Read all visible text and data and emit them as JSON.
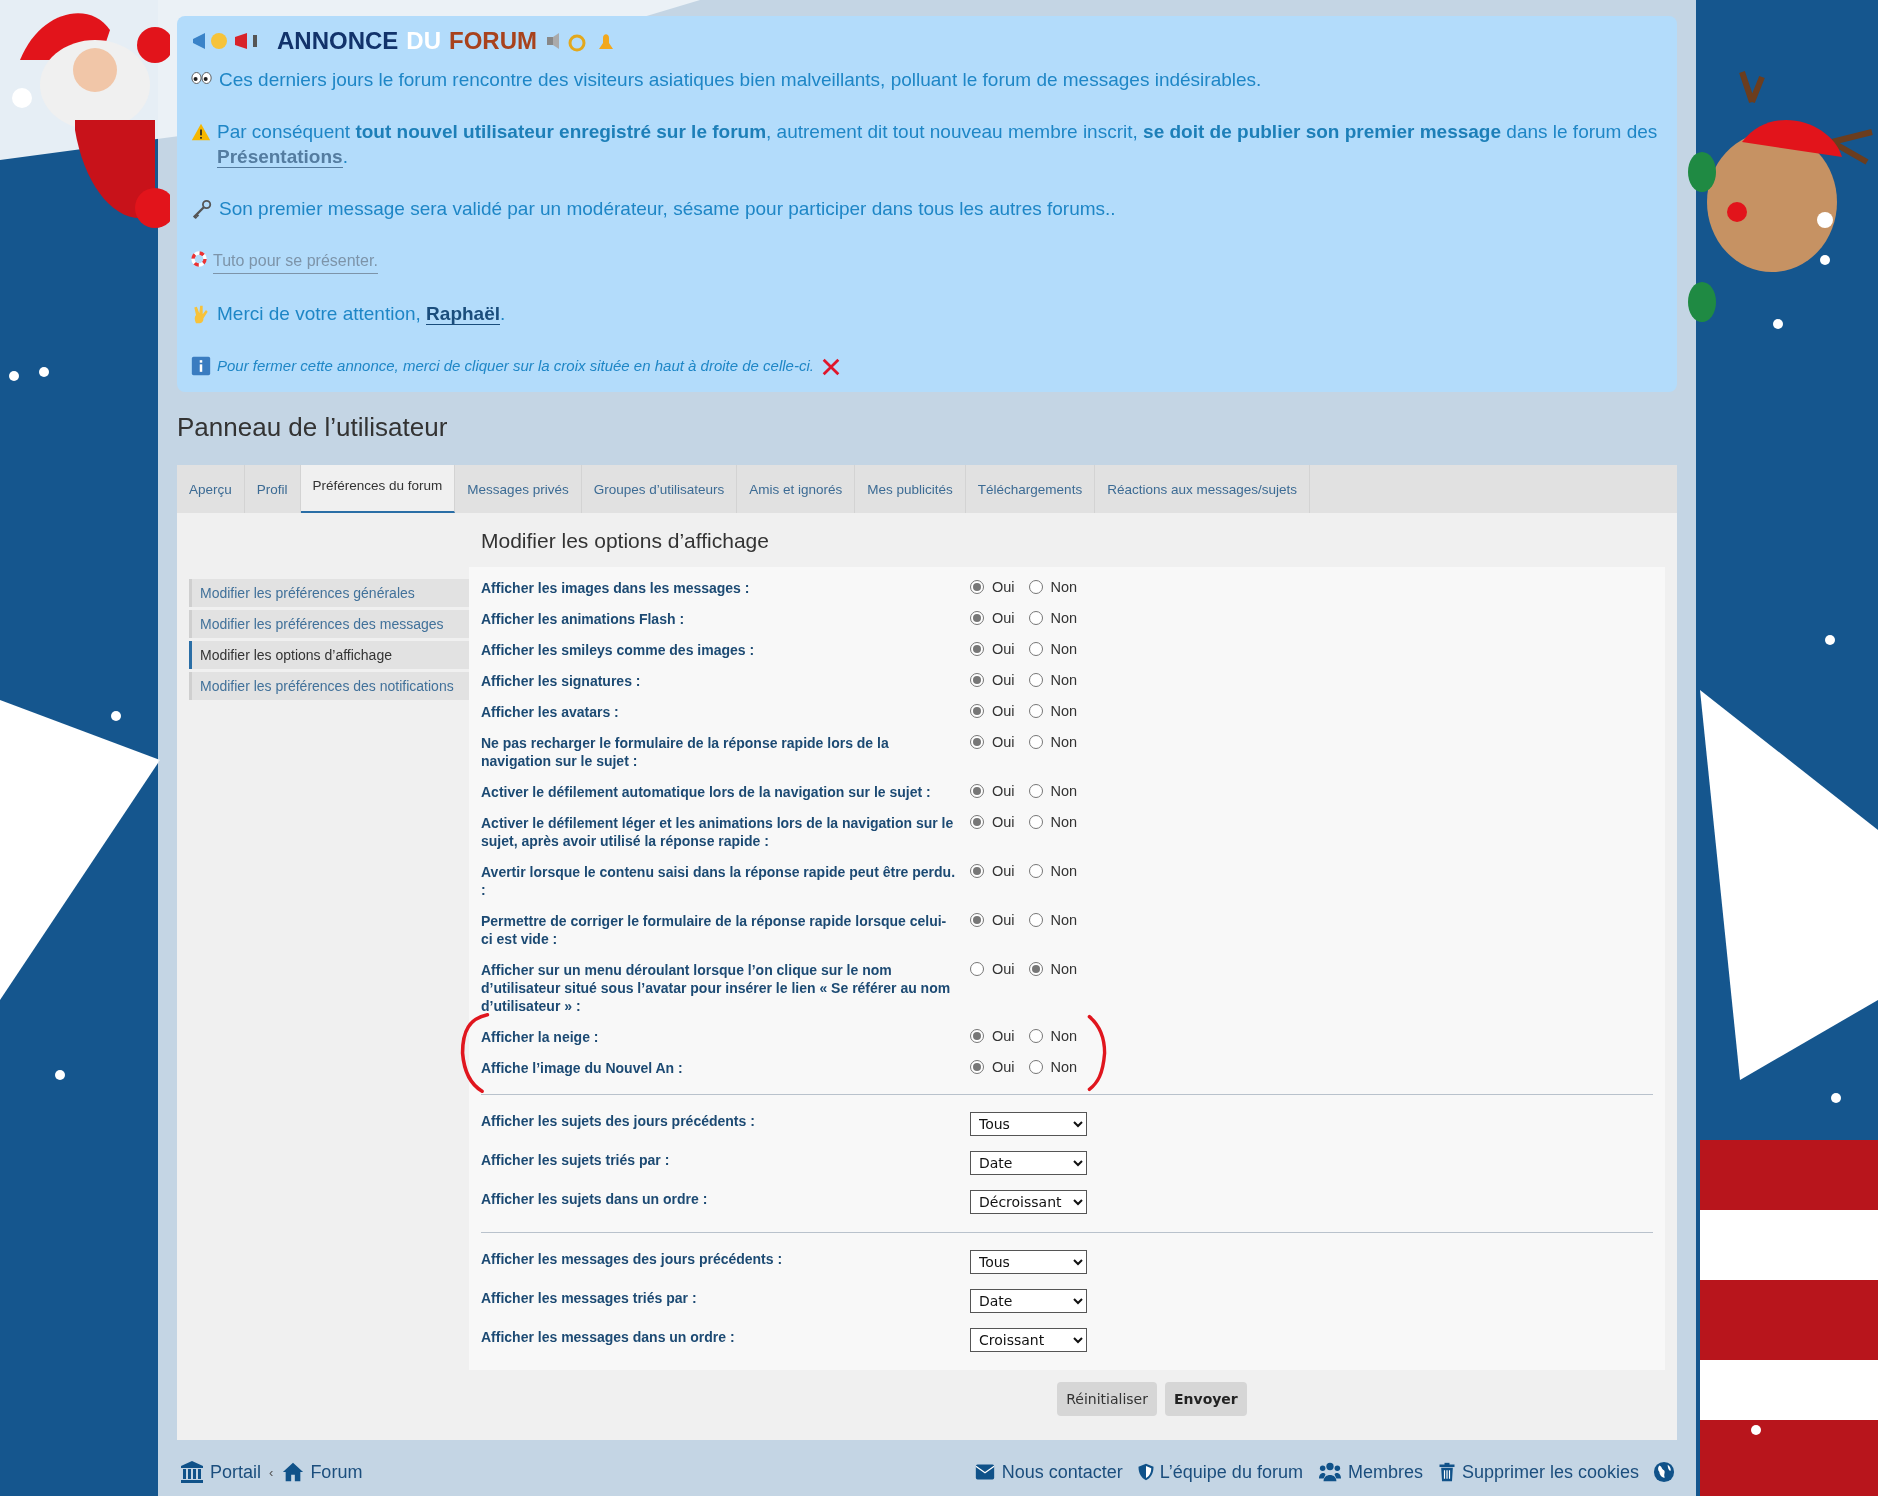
{
  "announcement": {
    "title_parts": [
      {
        "text": "ANNONCE",
        "color": "#12336b"
      },
      {
        "text": "DU",
        "color": "#ffffff"
      },
      {
        "text": "FORUM",
        "color": "#a8421c"
      }
    ],
    "paragraphs": [
      {
        "kind": "eyes",
        "text": "Ces derniers jours le forum rencontre des visiteurs asiatiques bien malveillants, polluant le forum de messages indésirables."
      },
      {
        "kind": "warning",
        "text": "Par conséquent **tout nouvel utilisateur enregistré sur le forum**, autrement dit tout nouveau membre inscrit, **se doit de publier son premier message** dans le forum des",
        "link": "Présentations",
        "after": "."
      },
      {
        "kind": "key",
        "text": "Son premier message sera validé par un modérateur, sésame pour participer dans tous les autres forums.."
      },
      {
        "kind": "lifebuoy",
        "link": "Tuto pour se présenter."
      },
      {
        "kind": "hand",
        "text": "Merci de votre attention,",
        "link": "Raphaël",
        "after": "."
      },
      {
        "kind": "info",
        "text": "Pour fermer cette annonce, merci de cliquer sur la croix située en haut à droite de celle-ci."
      }
    ]
  },
  "page_title": "Panneau de l’utilisateur",
  "tabs": [
    {
      "label": "Aperçu",
      "selected": false
    },
    {
      "label": "Profil",
      "selected": false
    },
    {
      "label": "Préférences du forum",
      "selected": true
    },
    {
      "label": "Messages privés",
      "selected": false
    },
    {
      "label": "Groupes d’utilisateurs",
      "selected": false
    },
    {
      "label": "Amis et ignorés",
      "selected": false
    },
    {
      "label": "Mes publicités",
      "selected": false
    },
    {
      "label": "Téléchargements",
      "selected": false
    },
    {
      "label": "Réactions aux messages/sujets",
      "selected": false
    }
  ],
  "sidebar": {
    "items": [
      {
        "label": "Modifier les préférences générales",
        "selected": false
      },
      {
        "label": "Modifier les préférences des messages",
        "selected": false
      },
      {
        "label": "Modifier les options d’affichage",
        "selected": true
      },
      {
        "label": "Modifier les préférences des notifications",
        "selected": false
      }
    ]
  },
  "section_title": "Modifier les options d’affichage",
  "groups": [
    {
      "rows": [
        {
          "kind": "radio",
          "label": "Afficher les images dans les messages :",
          "circled": false,
          "options": [
            {
              "label": "Oui",
              "selected": true
            },
            {
              "label": "Non",
              "selected": false
            }
          ]
        },
        {
          "kind": "radio",
          "label": "Afficher les animations Flash :",
          "circled": false,
          "options": [
            {
              "label": "Oui",
              "selected": true
            },
            {
              "label": "Non",
              "selected": false
            }
          ]
        },
        {
          "kind": "radio",
          "label": "Afficher les smileys comme des images :",
          "circled": false,
          "options": [
            {
              "label": "Oui",
              "selected": true
            },
            {
              "label": "Non",
              "selected": false
            }
          ]
        },
        {
          "kind": "radio",
          "label": "Afficher les signatures :",
          "circled": false,
          "options": [
            {
              "label": "Oui",
              "selected": true
            },
            {
              "label": "Non",
              "selected": false
            }
          ]
        },
        {
          "kind": "radio",
          "label": "Afficher les avatars :",
          "circled": false,
          "options": [
            {
              "label": "Oui",
              "selected": true
            },
            {
              "label": "Non",
              "selected": false
            }
          ]
        },
        {
          "kind": "radio",
          "label": "Ne pas recharger le formulaire de la réponse rapide lors de la navigation sur le sujet :",
          "circled": false,
          "options": [
            {
              "label": "Oui",
              "selected": true
            },
            {
              "label": "Non",
              "selected": false
            }
          ]
        },
        {
          "kind": "radio",
          "label": "Activer le défilement automatique lors de la navigation sur le sujet :",
          "circled": false,
          "options": [
            {
              "label": "Oui",
              "selected": true
            },
            {
              "label": "Non",
              "selected": false
            }
          ]
        },
        {
          "kind": "radio",
          "label": "Activer le défilement léger et les animations lors de la navigation sur le sujet, après avoir utilisé la réponse rapide :",
          "circled": false,
          "options": [
            {
              "label": "Oui",
              "selected": true
            },
            {
              "label": "Non",
              "selected": false
            }
          ]
        },
        {
          "kind": "radio",
          "label": "Avertir lorsque le contenu saisi dans la réponse rapide peut être perdu. :",
          "circled": false,
          "options": [
            {
              "label": "Oui",
              "selected": true
            },
            {
              "label": "Non",
              "selected": false
            }
          ]
        },
        {
          "kind": "radio",
          "label": "Permettre de corriger le formulaire de la réponse rapide lorsque celui-ci est vide :",
          "circled": false,
          "options": [
            {
              "label": "Oui",
              "selected": true
            },
            {
              "label": "Non",
              "selected": false
            }
          ]
        },
        {
          "kind": "radio",
          "label": "Afficher sur un menu déroulant lorsque l’on clique sur le nom d’utilisateur situé sous l’avatar pour insérer le lien « Se référer au nom d’utilisateur » :",
          "circled": false,
          "options": [
            {
              "label": "Oui",
              "selected": false
            },
            {
              "label": "Non",
              "selected": true
            }
          ]
        },
        {
          "kind": "radio",
          "label": "Afficher la neige :",
          "circled": true,
          "options": [
            {
              "label": "Oui",
              "selected": true
            },
            {
              "label": "Non",
              "selected": false
            }
          ]
        },
        {
          "kind": "radio",
          "label": "Affiche l’image du Nouvel An :",
          "circled": true,
          "options": [
            {
              "label": "Oui",
              "selected": true
            },
            {
              "label": "Non",
              "selected": false
            }
          ]
        }
      ]
    },
    {
      "rows": [
        {
          "kind": "select",
          "label": "Afficher les sujets des jours précédents :",
          "value": "Tous",
          "circled": false
        },
        {
          "kind": "select",
          "label": "Afficher les sujets triés par :",
          "value": "Date",
          "circled": false
        },
        {
          "kind": "select",
          "label": "Afficher les sujets dans un ordre :",
          "value": "Décroissant",
          "circled": false
        }
      ]
    },
    {
      "rows": [
        {
          "kind": "select",
          "label": "Afficher les messages des jours précédents :",
          "value": "Tous",
          "circled": false
        },
        {
          "kind": "select",
          "label": "Afficher les messages triés par :",
          "value": "Date",
          "circled": false
        },
        {
          "kind": "select",
          "label": "Afficher les messages dans un ordre :",
          "value": "Croissant",
          "circled": false
        }
      ]
    }
  ],
  "buttons": [
    {
      "label": "Réinitialiser",
      "kind": "reset"
    },
    {
      "label": "Envoyer",
      "kind": "submit"
    }
  ],
  "footer": {
    "left": [
      {
        "label": "Portail",
        "kind": "bank"
      },
      {
        "label": "Forum",
        "kind": "home"
      }
    ],
    "separator": "‹",
    "right": [
      {
        "label": "Nous contacter",
        "kind": "envelope"
      },
      {
        "label": "L’équipe du forum",
        "kind": "shield"
      },
      {
        "label": "Membres",
        "kind": "users"
      },
      {
        "label": "Supprimer les cookies",
        "kind": "trash"
      },
      {
        "kind": "globe"
      }
    ]
  }
}
